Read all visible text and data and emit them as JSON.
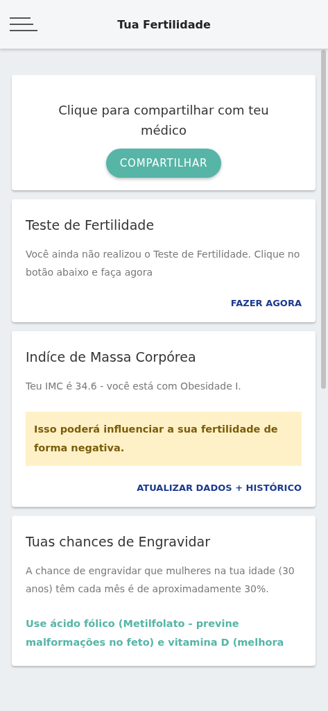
{
  "header": {
    "title": "Tua Fertilidade"
  },
  "cards": [
    {
      "kind": "share",
      "text": "Clique para compartilhar com teu médico",
      "button": "COMPARTILHAR"
    },
    {
      "kind": "info",
      "title": "Teste de Fertilidade",
      "text": "Você ainda não realizou o Teste de Fertilidade. Clique no botão abaixo e faça agora",
      "action": "FAZER AGORA"
    },
    {
      "kind": "info",
      "title": "Indíce de Massa Corpórea",
      "text": "Teu IMC é 34.6 - você está com Obesidade I.",
      "warning": "Isso poderá influenciar a sua fertilidade de forma negativa.",
      "action": "ATUALIZAR DADOS + HISTÓRICO"
    },
    {
      "kind": "info",
      "title": "Tuas chances de Engravidar",
      "text": "A chance de engravidar que mulheres na tua idade (30 anos) têm cada mês é de aproximadamente 30%.",
      "tip": "Use ácido fólico (Metilfolato - previne malformações no feto) e vitamina D (melhora"
    }
  ]
}
